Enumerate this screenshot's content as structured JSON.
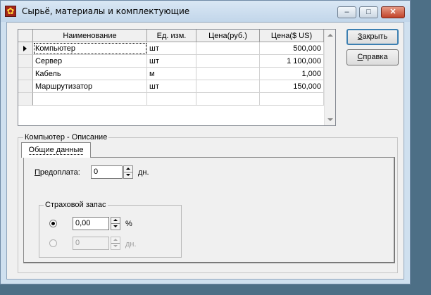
{
  "window": {
    "title": "Сырьё, материалы и комплектующие",
    "icon": "sunflower-icon",
    "minimize_glyph": "–",
    "maximize_glyph": "□",
    "close_glyph": "✕"
  },
  "grid": {
    "columns": [
      "Наименование",
      "Ед. изм.",
      "Цена(руб.)",
      "Цена($ US)"
    ],
    "rows": [
      {
        "name": "Компьютер",
        "unit": "шт",
        "price_rub": "",
        "price_usd": "500,000",
        "current": true
      },
      {
        "name": "Сервер",
        "unit": "шт",
        "price_rub": "",
        "price_usd": "1 100,000"
      },
      {
        "name": "Кабель",
        "unit": "м",
        "price_rub": "",
        "price_usd": "1,000"
      },
      {
        "name": "Маршрутизатор",
        "unit": "шт",
        "price_rub": "",
        "price_usd": "150,000"
      }
    ]
  },
  "buttons": {
    "close": {
      "hotkey": "З",
      "rest": "акрыть"
    },
    "help": {
      "hotkey": "С",
      "rest": "правка"
    }
  },
  "description": {
    "group_label": "Компьютер  - Описание",
    "tab_label": "Общие данные",
    "prepay": {
      "hotkey": "П",
      "rest": "редоплата:",
      "value": "0",
      "unit": "дн."
    },
    "reserve": {
      "label": "Страховой запас",
      "percent_value": "0,00",
      "percent_unit": "%",
      "days_value": "0",
      "days_unit": "дн.",
      "selected": "percent"
    }
  }
}
